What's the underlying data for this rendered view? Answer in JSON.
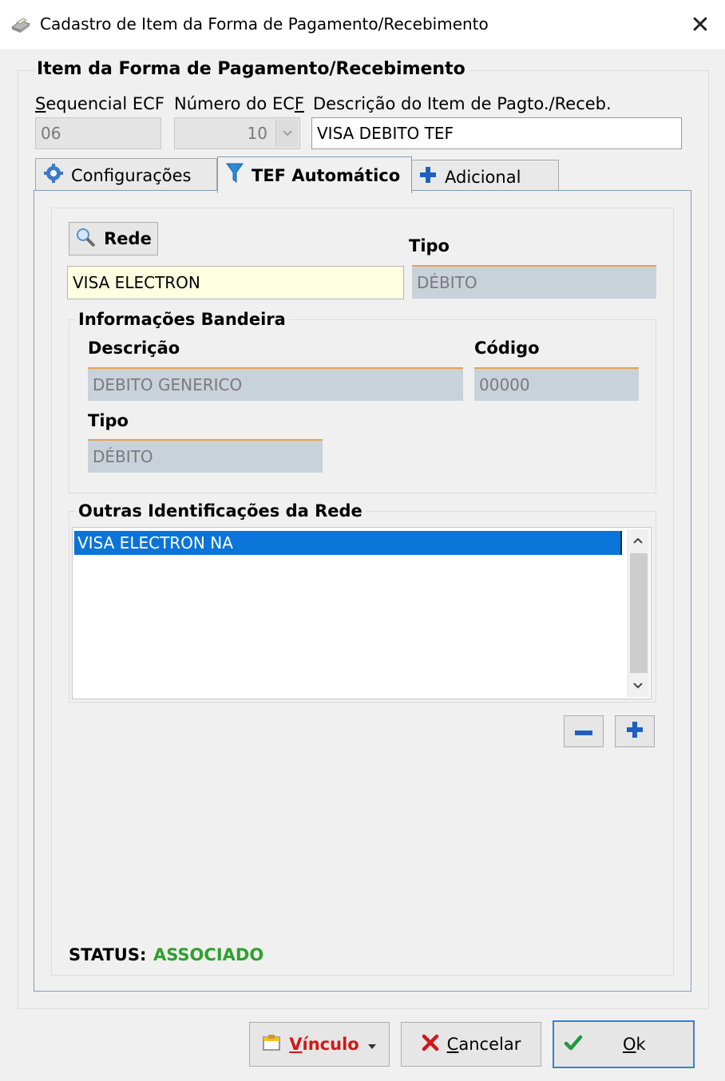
{
  "window": {
    "title": "Cadastro de Item da Forma de Pagamento/Recebimento",
    "close_glyph": "✕",
    "icon": "printer-icon"
  },
  "group": {
    "title": "Item da Forma de Pagamento/Recebimento"
  },
  "fields": {
    "sequencial": {
      "label_u": "S",
      "label_rest": "equencial ECF",
      "value": "06"
    },
    "numero_ecf": {
      "label_pre": "Número do EC",
      "label_u": "F",
      "value": "10"
    },
    "descricao_item": {
      "label": "Descrição do Item de Pagto./Receb.",
      "value": "VISA DEBITO TEF"
    }
  },
  "tabs": [
    {
      "label": "Configurações",
      "icon": "gear-icon",
      "active": false
    },
    {
      "label": "TEF Automático",
      "icon": "filter-icon",
      "active": true
    },
    {
      "label": "Adicional",
      "icon": "plus-icon",
      "active": false
    }
  ],
  "tef": {
    "rede_button": "Rede",
    "rede_value": "VISA ELECTRON",
    "tipo_label": "Tipo",
    "tipo_value": "DÉBITO",
    "bandeira": {
      "title": "Informações Bandeira",
      "descricao_label": "Descrição",
      "descricao_value": "DEBITO GENERICO",
      "codigo_label": "Código",
      "codigo_value": "00000",
      "tipo_label": "Tipo",
      "tipo_value": "DÉBITO"
    },
    "outras": {
      "title": "Outras Identificações da Rede",
      "items": [
        "VISA ELECTRON NA"
      ]
    },
    "status_label": "STATUS:",
    "status_value": "ASSOCIADO"
  },
  "footer": {
    "vinculo_u": "V",
    "vinculo_rest": "ínculo",
    "cancelar_u": "C",
    "cancelar_rest": "ancelar",
    "ok_u": "O",
    "ok_rest": "k"
  },
  "colors": {
    "selection": "#0a74d8",
    "status_green": "#2ea02e",
    "vinculo_red": "#d01818",
    "field_accent": "#e8a251"
  }
}
